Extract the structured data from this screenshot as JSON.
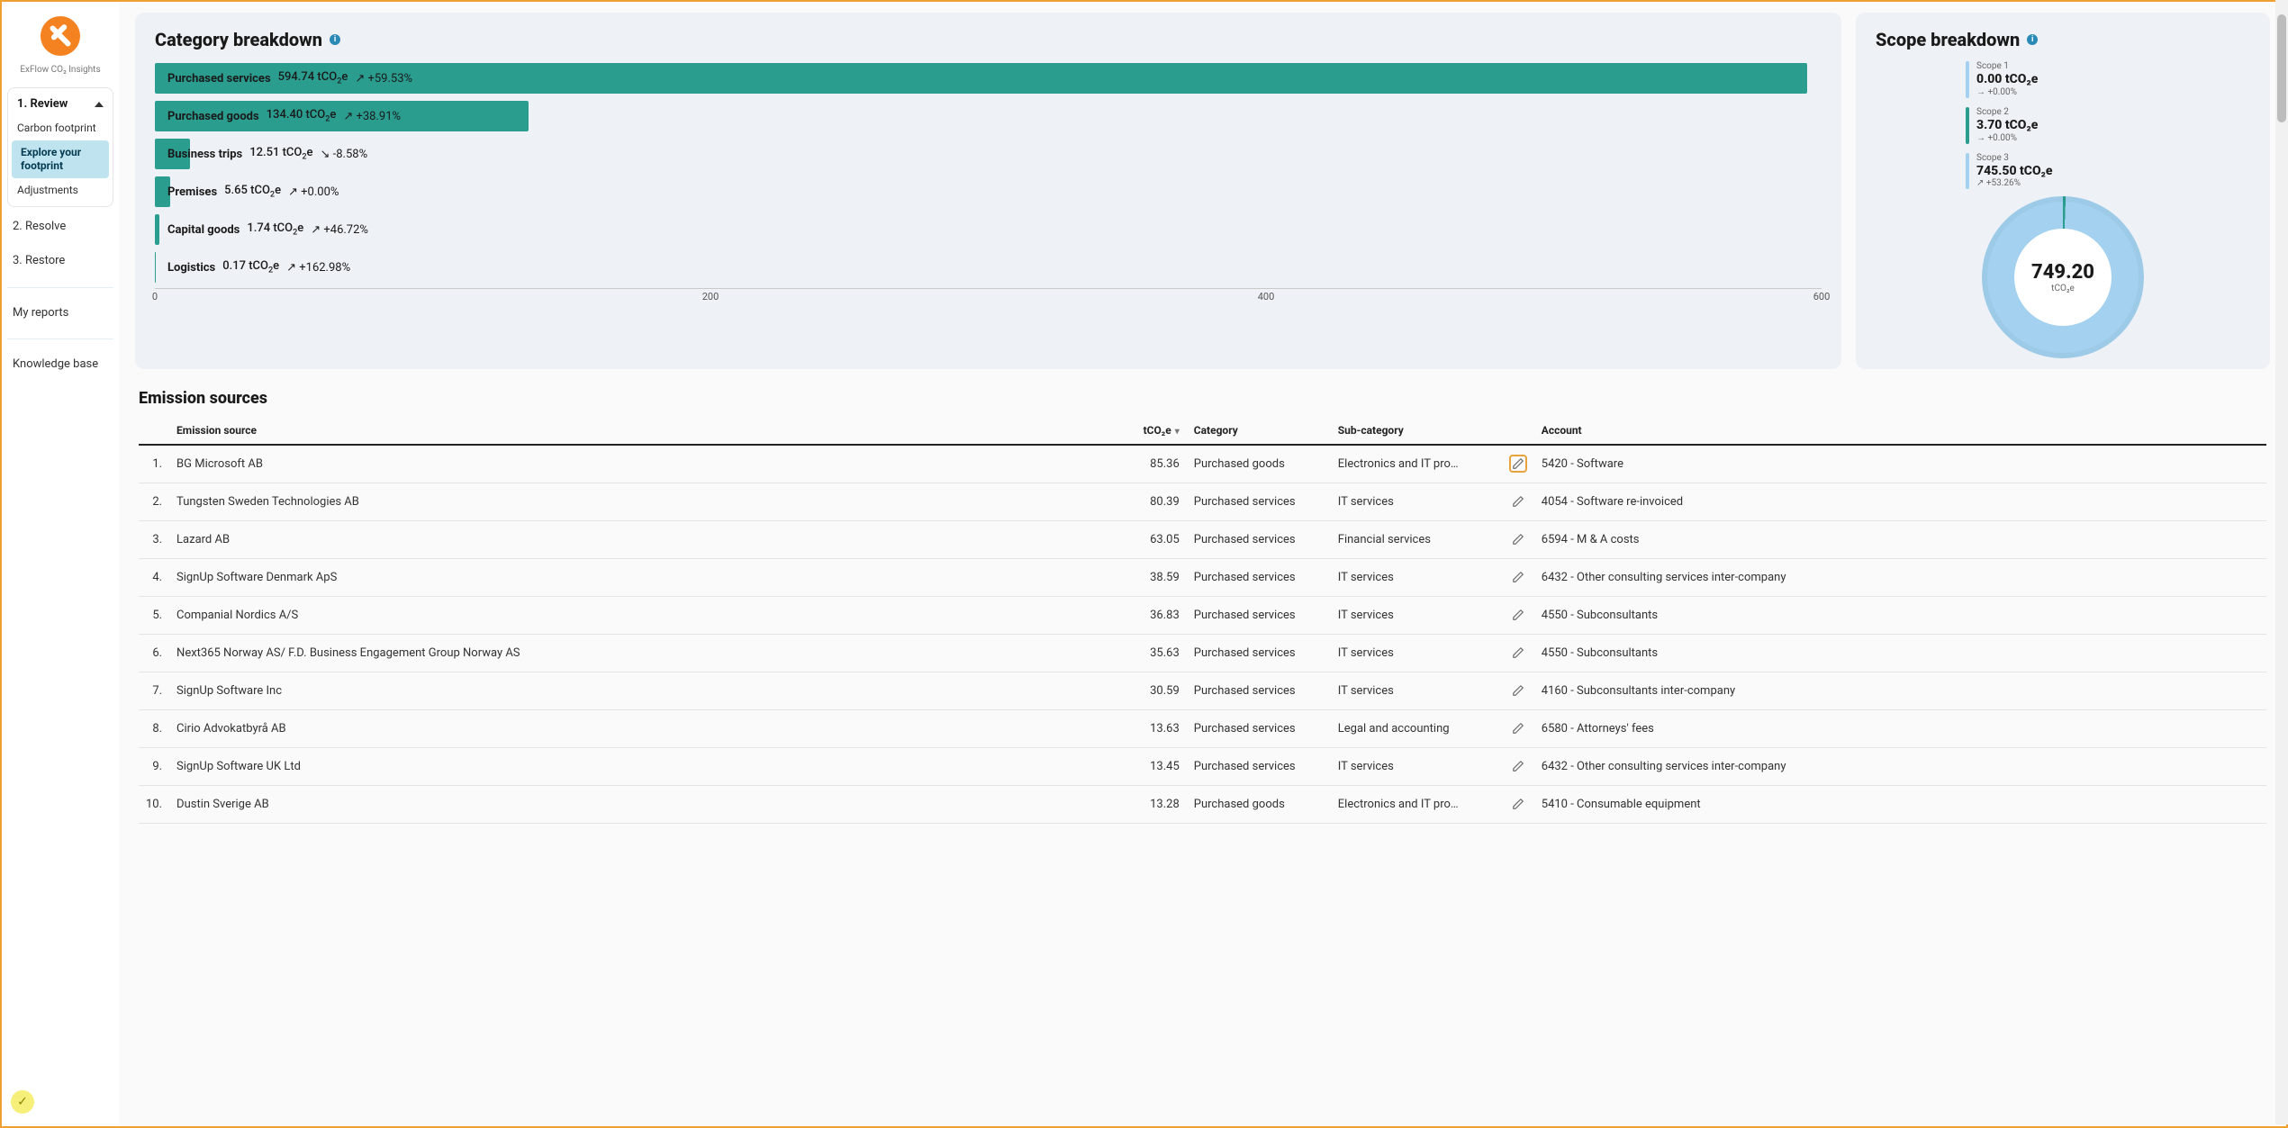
{
  "brand": {
    "name": "ExFlow CO₂ Insights"
  },
  "nav": {
    "review": {
      "label": "1. Review",
      "children": [
        {
          "id": "carbon-footprint",
          "label": "Carbon footprint",
          "active": false
        },
        {
          "id": "explore",
          "label": "Explore your footprint",
          "active": true
        },
        {
          "id": "adjustments",
          "label": "Adjustments",
          "active": false
        }
      ]
    },
    "resolve": {
      "label": "2. Resolve"
    },
    "restore": {
      "label": "3. Restore"
    },
    "reports": {
      "label": "My reports"
    },
    "kb": {
      "label": "Knowledge base"
    }
  },
  "category_breakdown": {
    "title": "Category breakdown",
    "unit": "tCO₂e",
    "axis": {
      "min": 0,
      "max": 600,
      "ticks": [
        0,
        200,
        400,
        600
      ]
    }
  },
  "chart_data": {
    "type": "bar",
    "title": "Category breakdown",
    "xlabel": "",
    "ylabel": "tCO₂e",
    "ylim": [
      0,
      600
    ],
    "categories": [
      "Purchased services",
      "Purchased goods",
      "Business trips",
      "Premises",
      "Capital goods",
      "Logistics"
    ],
    "values": [
      594.74,
      134.4,
      12.51,
      5.65,
      1.74,
      0.17
    ],
    "deltas_pct": [
      59.53,
      38.91,
      -8.58,
      0.0,
      46.72,
      162.98
    ]
  },
  "scope_breakdown": {
    "title": "Scope breakdown",
    "scopes": [
      {
        "name": "Scope 1",
        "value": "0.00 tCO₂e",
        "delta": "→ +0.00%",
        "color": "#a3d1ef"
      },
      {
        "name": "Scope 2",
        "value": "3.70 tCO₂e",
        "delta": "→ +0.00%",
        "color": "#2a9d8f"
      },
      {
        "name": "Scope 3",
        "value": "745.50 tCO₂e",
        "delta": "↗ +53.26%",
        "color": "#a3d1ef"
      }
    ],
    "total": {
      "value": "749.20",
      "unit": "tCO₂e"
    }
  },
  "sources": {
    "title": "Emission sources",
    "columns": {
      "source": "Emission source",
      "tco2e": "tCO₂e",
      "category": "Category",
      "subcategory": "Sub-category",
      "account": "Account"
    },
    "rows": [
      {
        "n": "1.",
        "source": "BG Microsoft AB",
        "tco2e": "85.36",
        "category": "Purchased goods",
        "subcategory": "Electronics and IT pro…",
        "account": "5420 - Software",
        "highlight_edit": true
      },
      {
        "n": "2.",
        "source": "Tungsten Sweden Technologies AB",
        "tco2e": "80.39",
        "category": "Purchased services",
        "subcategory": "IT services",
        "account": "4054 - Software re-invoiced"
      },
      {
        "n": "3.",
        "source": "Lazard AB",
        "tco2e": "63.05",
        "category": "Purchased services",
        "subcategory": "Financial services",
        "account": "6594 - M & A costs"
      },
      {
        "n": "4.",
        "source": "SignUp Software Denmark ApS",
        "tco2e": "38.59",
        "category": "Purchased services",
        "subcategory": "IT services",
        "account": "6432 - Other consulting services inter-company"
      },
      {
        "n": "5.",
        "source": "Companial Nordics A/S",
        "tco2e": "36.83",
        "category": "Purchased services",
        "subcategory": "IT services",
        "account": "4550 - Subconsultants"
      },
      {
        "n": "6.",
        "source": "Next365 Norway AS/ F.D. Business Engagement Group Norway AS",
        "tco2e": "35.63",
        "category": "Purchased services",
        "subcategory": "IT services",
        "account": "4550 - Subconsultants"
      },
      {
        "n": "7.",
        "source": "SignUp Software Inc",
        "tco2e": "30.59",
        "category": "Purchased services",
        "subcategory": "IT services",
        "account": "4160 - Subconsultants inter-company"
      },
      {
        "n": "8.",
        "source": "Cirio Advokatbyrå AB",
        "tco2e": "13.63",
        "category": "Purchased services",
        "subcategory": "Legal and accounting",
        "account": "6580 - Attorneys' fees"
      },
      {
        "n": "9.",
        "source": "SignUp Software UK Ltd",
        "tco2e": "13.45",
        "category": "Purchased services",
        "subcategory": "IT services",
        "account": "6432 - Other consulting services inter-company"
      },
      {
        "n": "10.",
        "source": "Dustin Sverige AB",
        "tco2e": "13.28",
        "category": "Purchased goods",
        "subcategory": "Electronics and IT pro…",
        "account": "5410 - Consumable equipment"
      }
    ]
  }
}
